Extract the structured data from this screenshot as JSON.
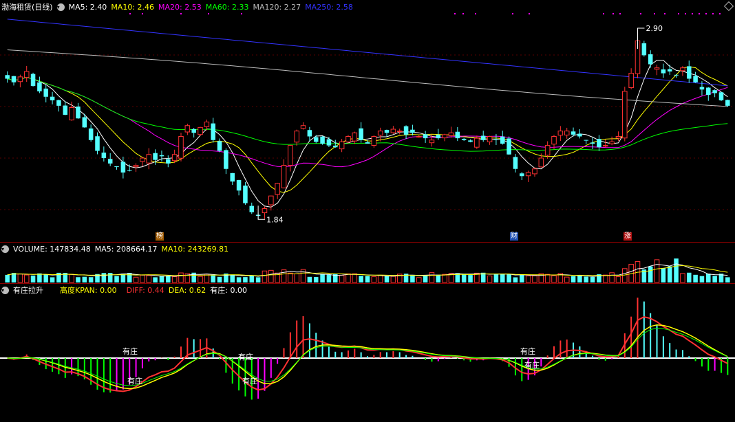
{
  "price_header": {
    "title": "渤海租赁(日线)",
    "ma5": "MA5: 2.40",
    "ma10": "MA10: 2.46",
    "ma20": "MA20: 2.53",
    "ma60": "MA60: 2.33",
    "ma120": "MA120: 2.27",
    "ma250": "MA250: 2.58"
  },
  "volume_header": {
    "volume": "VOLUME: 147834.48",
    "ma5": "MA5: 208664.17",
    "ma10": "MA10: 243269.81"
  },
  "indicator_header": {
    "name": "有庄拉升",
    "kpan": "高度KPAN: 0.00",
    "diff": "DIFF: 0.44",
    "dea": "DEA: 0.62",
    "youzhuang": "有庄: 0.00"
  },
  "annotations": {
    "high_price": "2.90",
    "low_price": "1.84",
    "tag_bang": "榜",
    "tag_cai": "财",
    "tag_zhang": "涨",
    "youzhuang_label": "有庄"
  },
  "colors": {
    "up": "#ff3232",
    "down": "#54ffff",
    "ma5": "#ffffff",
    "ma10": "#ffff00",
    "ma20": "#ff00ff",
    "ma60": "#00ff00",
    "ma120": "#bbbbbb",
    "ma250": "#3333ff",
    "grid": "#8b0000"
  },
  "chart_data": {
    "type": "candlestick",
    "price_range": [
      1.84,
      2.9
    ],
    "close": [
      2.62,
      2.6,
      2.63,
      2.66,
      2.58,
      2.55,
      2.52,
      2.5,
      2.47,
      2.42,
      2.46,
      2.4,
      2.35,
      2.28,
      2.22,
      2.18,
      2.15,
      2.13,
      2.1,
      2.11,
      2.14,
      2.18,
      2.2,
      2.17,
      2.19,
      2.15,
      2.2,
      2.3,
      2.36,
      2.32,
      2.35,
      2.38,
      2.28,
      2.22,
      2.12,
      2.05,
      2.0,
      1.93,
      1.88,
      1.86,
      1.9,
      1.97,
      2.04,
      2.14,
      2.25,
      2.33,
      2.36,
      2.3,
      2.27,
      2.26,
      2.25,
      2.24,
      2.27,
      2.3,
      2.32,
      2.28,
      2.26,
      2.3,
      2.33,
      2.32,
      2.34,
      2.33,
      2.31,
      2.32,
      2.3,
      2.29,
      2.28,
      2.29,
      2.31,
      2.32,
      2.29,
      2.28,
      2.27,
      2.29,
      2.28,
      2.3,
      2.28,
      2.26,
      2.2,
      2.12,
      2.08,
      2.1,
      2.12,
      2.18,
      2.25,
      2.3,
      2.33,
      2.33,
      2.31,
      2.3,
      2.28,
      2.26,
      2.24,
      2.25,
      2.27,
      2.3,
      2.55,
      2.65,
      2.83,
      2.75,
      2.7,
      2.68,
      2.65,
      2.66,
      2.64,
      2.68,
      2.62,
      2.6,
      2.56,
      2.53,
      2.54,
      2.5,
      2.47
    ],
    "volume_header_value": 147834.48
  }
}
